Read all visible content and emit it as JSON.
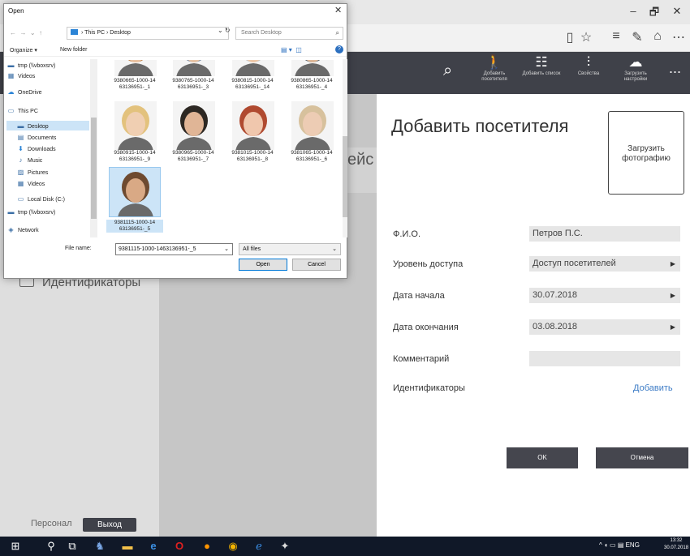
{
  "browser": {
    "minimize": "–",
    "maximize": "🗗",
    "close": "✕",
    "toolbar_icons": [
      "reading-view-icon",
      "favorite-star-icon",
      "hub-icon",
      "notes-icon",
      "share-icon",
      "more-icon"
    ]
  },
  "appbar": {
    "search_icon": "⌕",
    "more": "...",
    "items": [
      {
        "label": "Добавить посетителя",
        "icon": "🚶"
      },
      {
        "label": "Добавить список",
        "icon": "☷"
      },
      {
        "label": "Свойства",
        "icon": "⫶"
      },
      {
        "label": "Загрузить настройки",
        "icon": "☁"
      }
    ]
  },
  "sidebar": {
    "identifiers": "Идентификаторы",
    "staff": "Персонал",
    "logout": "Выход"
  },
  "mid": {
    "partial_text": "ейс"
  },
  "form": {
    "title": "Добавить посетителя",
    "upload_photo": "Загрузить фотографию",
    "fields": [
      {
        "label": "Ф.И.О.",
        "value": "Петров П.С."
      },
      {
        "label": "Уровень доступа",
        "value": "Доступ посетителей"
      },
      {
        "label": "Дата начала",
        "value": "30.07.2018"
      },
      {
        "label": "Дата окончания",
        "value": "03.08.2018"
      },
      {
        "label": "Комментарий",
        "value": ""
      }
    ],
    "identifiers_label": "Идентификаторы",
    "add_link": "Добавить",
    "ok": "OK",
    "cancel": "Отмена"
  },
  "taskbar": {
    "tray": "^ ◖ ▭ ▤ ENG",
    "time": "13:32",
    "date": "30.07.2018"
  },
  "dialog": {
    "title": "Open",
    "close": "✕",
    "path": "› This PC › Desktop",
    "search_placeholder": "Search Desktop",
    "organize": "Organize ▾",
    "new_folder": "New folder",
    "nav": [
      {
        "label": "tmp (\\\\vboxsrv)",
        "icon": "▬"
      },
      {
        "label": "Videos",
        "icon": "▦"
      },
      {
        "label": "OneDrive",
        "icon": "☁"
      },
      {
        "label": "This PC",
        "icon": "▭"
      },
      {
        "label": "Desktop",
        "icon": "▬"
      },
      {
        "label": "Documents",
        "icon": "▤"
      },
      {
        "label": "Downloads",
        "icon": "⬇"
      },
      {
        "label": "Music",
        "icon": "♪"
      },
      {
        "label": "Pictures",
        "icon": "▨"
      },
      {
        "label": "Videos",
        "icon": "▦"
      },
      {
        "label": "Local Disk (C:)",
        "icon": "▭"
      },
      {
        "label": "tmp (\\\\vboxsrv)",
        "icon": "▬"
      },
      {
        "label": "Network",
        "icon": "◈"
      }
    ],
    "files": [
      {
        "name": "9380665-1000-14 63136951-_1",
        "skin": "#e8c0a0",
        "hair": "#c58a52"
      },
      {
        "name": "9380765-1000-14 63136951-_3",
        "skin": "#e7c3a4",
        "hair": "#7d8ea6"
      },
      {
        "name": "9380815-1000-14 63136951-_14",
        "skin": "#eec8a8",
        "hair": "#c9c9c9"
      },
      {
        "name": "9380865-1000-14 63136951-_4",
        "skin": "#dfb898",
        "hair": "#636e78"
      },
      {
        "name": "9380915-1000-14 63136951-_9",
        "skin": "#f0cfb2",
        "hair": "#e3c27d"
      },
      {
        "name": "9380965-1000-14 63136951-_7",
        "skin": "#e0b596",
        "hair": "#2d2823"
      },
      {
        "name": "9381015-1000-14 63136951-_8",
        "skin": "#f0c7ad",
        "hair": "#b04a30"
      },
      {
        "name": "9381065-1000-14 63136951-_6",
        "skin": "#edccb4",
        "hair": "#d7c19d"
      },
      {
        "name": "9381115-1000-14 63136951-_5",
        "skin": "#d9a985",
        "hair": "#6e4a30"
      }
    ],
    "file_name_label": "File name:",
    "file_name_value": "9381115-1000-1463136951-_5",
    "filter": "All files",
    "open": "Open",
    "cancel": "Cancel"
  }
}
